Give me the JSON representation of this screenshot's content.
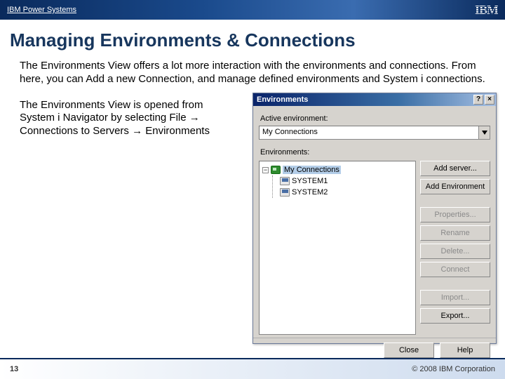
{
  "header": {
    "brand": "IBM Power Systems",
    "logo_text": "IBM"
  },
  "title": "Managing Environments & Connections",
  "paragraph1": "The Environments View offers a lot more interaction with the environments and connections.  From here, you can Add a new Connection, and manage defined environments and System i connections.",
  "paragraph2_prefix": "The Environments View is opened from System i Navigator by selecting File ",
  "paragraph2_mid": " Connections to Servers ",
  "paragraph2_suffix": " Environments",
  "arrow_glyph": "→",
  "dialog": {
    "title": "Environments",
    "active_label": "Active environment:",
    "active_value": "My Connections",
    "env_label": "Environments:",
    "tree": {
      "root": "My Connections",
      "children": [
        "SYSTEM1",
        "SYSTEM2"
      ]
    },
    "buttons": {
      "add_server": "Add server...",
      "add_env": "Add Environment",
      "properties": "Properties...",
      "rename": "Rename",
      "delete": "Delete...",
      "connect": "Connect",
      "import": "Import...",
      "export": "Export...",
      "close": "Close",
      "help": "Help"
    }
  },
  "footer": {
    "page": "13",
    "copyright": "© 2008 IBM Corporation"
  }
}
